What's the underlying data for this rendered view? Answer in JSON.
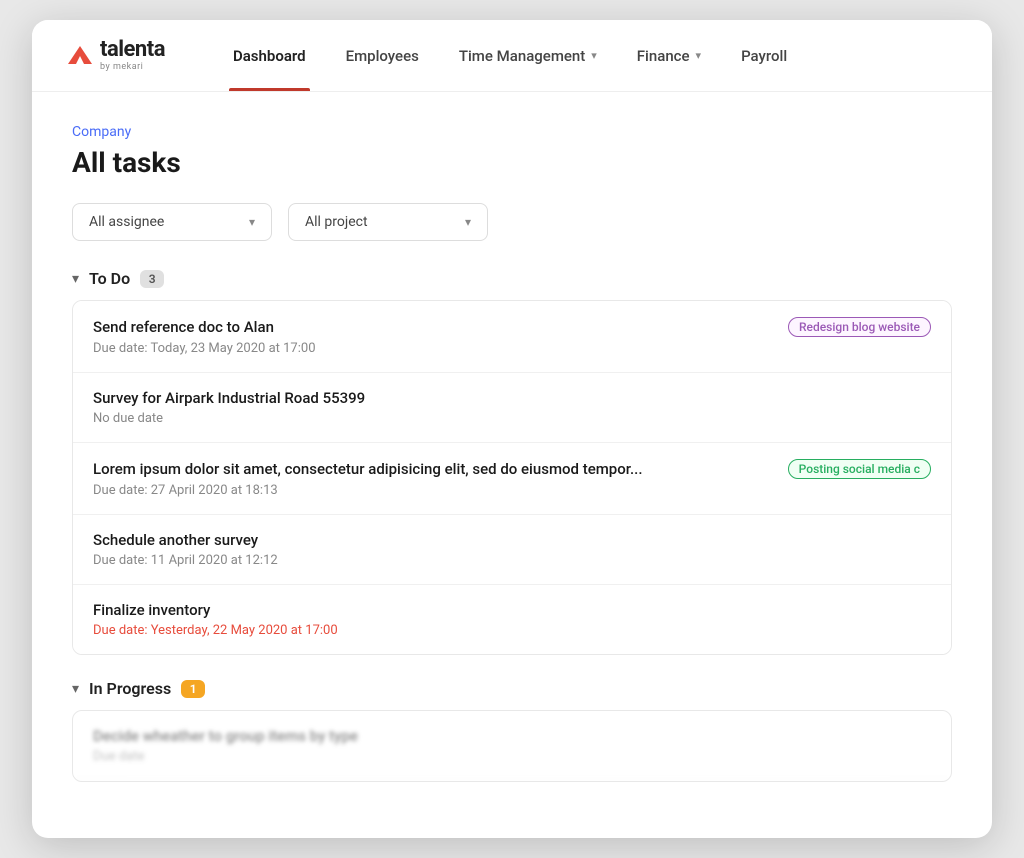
{
  "app": {
    "logo_main": "talenta",
    "logo_sub": "by mekari",
    "logo_icon_color": "#e74c3c"
  },
  "nav": {
    "items": [
      {
        "id": "dashboard",
        "label": "Dashboard",
        "active": true,
        "has_caret": false
      },
      {
        "id": "employees",
        "label": "Employees",
        "active": false,
        "has_caret": false
      },
      {
        "id": "time-management",
        "label": "Time Management",
        "active": false,
        "has_caret": true
      },
      {
        "id": "finance",
        "label": "Finance",
        "active": false,
        "has_caret": true
      },
      {
        "id": "payroll",
        "label": "Payroll",
        "active": false,
        "has_caret": false
      }
    ]
  },
  "breadcrumb": "Company",
  "page_title": "All tasks",
  "filters": {
    "assignee": {
      "label": "All assignee",
      "options": [
        "All assignee"
      ]
    },
    "project": {
      "label": "All project",
      "options": [
        "All project"
      ]
    }
  },
  "sections": [
    {
      "id": "todo",
      "title": "To Do",
      "count": "3",
      "badge_type": "default",
      "tasks": [
        {
          "id": "task1",
          "name": "Send reference doc to Alan",
          "tag": {
            "label": "Redesign blog website",
            "type": "purple"
          },
          "due": "Due date: Today, 23 May 2020 at 17:00",
          "overdue": false
        },
        {
          "id": "task2",
          "name": "Survey for Airpark Industrial Road 55399",
          "tag": null,
          "due": "No due date",
          "overdue": false
        },
        {
          "id": "task3",
          "name": "Lorem ipsum dolor sit amet, consectetur adipisicing elit, sed do eiusmod tempor...",
          "tag": {
            "label": "Posting social media c",
            "type": "green"
          },
          "due": "Due date: 27 April 2020 at 18:13",
          "overdue": false
        },
        {
          "id": "task4",
          "name": "Schedule another survey",
          "tag": null,
          "due": "Due date: 11 April 2020 at 12:12",
          "overdue": false
        },
        {
          "id": "task5",
          "name": "Finalize inventory",
          "tag": null,
          "due": "Due date: Yesterday, 22 May 2020 at 17:00",
          "overdue": true
        }
      ]
    },
    {
      "id": "in-progress",
      "title": "In Progress",
      "count": "1",
      "badge_type": "orange",
      "tasks": [
        {
          "id": "task6",
          "name": "Decide wheather to group items by type",
          "tag": null,
          "due": "Due date",
          "overdue": false,
          "blurred": true
        }
      ]
    }
  ]
}
